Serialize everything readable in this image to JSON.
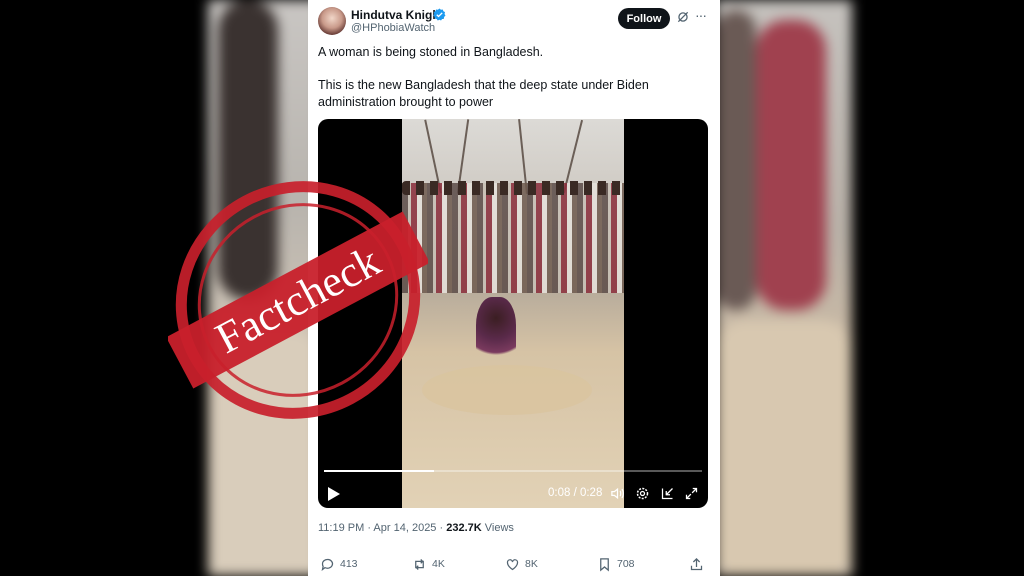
{
  "tweet": {
    "display_name": "Hindutva Knight",
    "handle": "@HPhobiaWatch",
    "follow_label": "Follow",
    "text_line1": "A woman is being stoned in Bangladesh.",
    "text_line2": "This is the new Bangladesh that the deep state under Biden",
    "text_line3": "administration brought to power",
    "timestamp": "11:19 PM · Apr 14, 2025 ·",
    "views_count": "232.7K",
    "views_label": "Views"
  },
  "video": {
    "time_display": "0:08 / 0:28",
    "progress": 0.29
  },
  "actions": {
    "replies": "413",
    "reposts": "4K",
    "likes": "8K",
    "bookmarks": "708"
  },
  "stamp": {
    "text": "Factcheck",
    "color": "#c8202b"
  },
  "colors": {
    "text_primary": "#0f1419",
    "text_secondary": "#536471",
    "verified_blue": "#1d9bf0"
  },
  "icons": [
    "verified-badge-icon",
    "grok-icon",
    "more-icon",
    "play-icon",
    "volume-icon",
    "settings-icon",
    "mini-player-icon",
    "fullscreen-icon",
    "reply-icon",
    "repost-icon",
    "like-icon",
    "bookmark-icon",
    "share-icon"
  ]
}
